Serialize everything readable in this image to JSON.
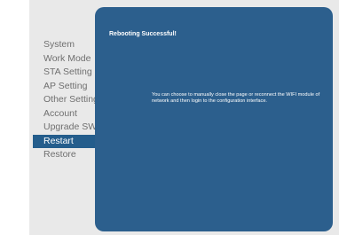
{
  "sidebar": {
    "items": [
      {
        "label": "System"
      },
      {
        "label": "Work Mode"
      },
      {
        "label": "STA Setting"
      },
      {
        "label": "AP Setting"
      },
      {
        "label": "Other Setting"
      },
      {
        "label": "Account"
      },
      {
        "label": "Upgrade SW"
      },
      {
        "label": "Restart"
      },
      {
        "label": "Restore"
      }
    ],
    "active_item": "Restart"
  },
  "panel": {
    "title": "Rebooting Successful!",
    "message": "You can choose to manually close the page or reconnect the WIFI module of network and then login to the configuration interface."
  },
  "colors": {
    "panel_background": "#2c5f8d",
    "active_nav_background": "#245d8c",
    "frame_background": "#e9e9e9",
    "nav_text": "#6f6f6f"
  }
}
